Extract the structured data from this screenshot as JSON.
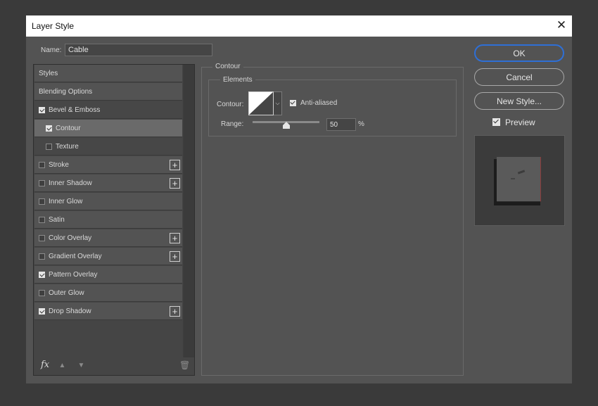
{
  "window": {
    "title": "Layer Style"
  },
  "name_field": {
    "label": "Name:",
    "value": "Cable"
  },
  "styles": [
    {
      "label": "Styles",
      "checkbox": false,
      "checked": false,
      "plus": false,
      "indent": false
    },
    {
      "label": "Blending Options",
      "checkbox": false,
      "checked": false,
      "plus": false,
      "indent": false
    },
    {
      "label": "Bevel & Emboss",
      "checkbox": true,
      "checked": true,
      "plus": false,
      "indent": false
    },
    {
      "label": "Contour",
      "checkbox": true,
      "checked": true,
      "plus": false,
      "indent": true,
      "selected": true
    },
    {
      "label": "Texture",
      "checkbox": true,
      "checked": false,
      "plus": false,
      "indent": true
    },
    {
      "label": "Stroke",
      "checkbox": true,
      "checked": false,
      "plus": true,
      "indent": false
    },
    {
      "label": "Inner Shadow",
      "checkbox": true,
      "checked": false,
      "plus": true,
      "indent": false
    },
    {
      "label": "Inner Glow",
      "checkbox": true,
      "checked": false,
      "plus": false,
      "indent": false
    },
    {
      "label": "Satin",
      "checkbox": true,
      "checked": false,
      "plus": false,
      "indent": false
    },
    {
      "label": "Color Overlay",
      "checkbox": true,
      "checked": false,
      "plus": true,
      "indent": false
    },
    {
      "label": "Gradient Overlay",
      "checkbox": true,
      "checked": false,
      "plus": true,
      "indent": false
    },
    {
      "label": "Pattern Overlay",
      "checkbox": true,
      "checked": true,
      "plus": false,
      "indent": false
    },
    {
      "label": "Outer Glow",
      "checkbox": true,
      "checked": false,
      "plus": false,
      "indent": false
    },
    {
      "label": "Drop Shadow",
      "checkbox": true,
      "checked": true,
      "plus": true,
      "indent": false
    }
  ],
  "footer": {
    "fx_label": "fx"
  },
  "panel": {
    "title": "Contour",
    "group_title": "Elements",
    "contour_label": "Contour:",
    "anti_aliased_label": "Anti-aliased",
    "anti_aliased": true,
    "range_label": "Range:",
    "range_value": "50",
    "range_unit": "%",
    "range_fraction": 0.5
  },
  "buttons": {
    "ok": "OK",
    "cancel": "Cancel",
    "new_style": "New Style..."
  },
  "preview": {
    "label": "Preview",
    "checked": true
  },
  "colors": {
    "accent": "#2e6fd6",
    "dialog_bg": "#535353",
    "title_bg": "#ffffff"
  }
}
